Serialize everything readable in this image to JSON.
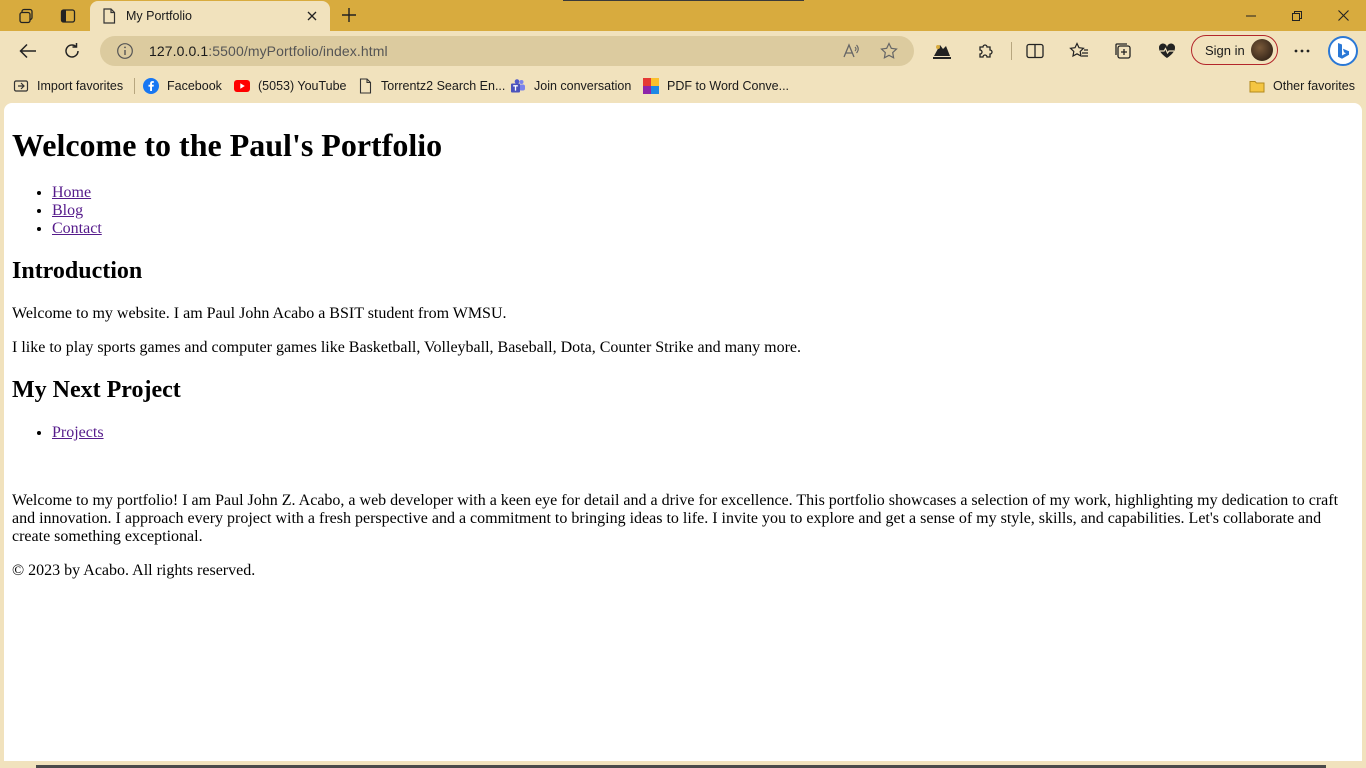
{
  "browser": {
    "tab_title": "My Portfolio",
    "url_host": "127.0.0.1",
    "url_path": ":5500/myPortfolio/index.html",
    "signin_label": "Sign in",
    "accent_color": "#d8ab3e",
    "favorites": [
      {
        "label": "Import favorites",
        "icon": "import-icon"
      },
      {
        "label": "Facebook",
        "icon": "facebook-icon"
      },
      {
        "label": "(5053) YouTube",
        "icon": "youtube-icon"
      },
      {
        "label": "Torrentz2 Search En...",
        "icon": "page-icon"
      },
      {
        "label": "Join conversation",
        "icon": "teams-icon"
      },
      {
        "label": "PDF to Word Conve...",
        "icon": "pdf-icon"
      }
    ],
    "other_favorites": "Other favorites"
  },
  "page": {
    "title": "Welcome to the Paul's Portfolio",
    "nav": [
      "Home",
      "Blog",
      "Contact"
    ],
    "intro_heading": "Introduction",
    "intro_p1": "Welcome to my website. I am Paul John Acabo a BSIT student from WMSU.",
    "intro_p2": "I like to play sports games and computer games like Basketball, Volleyball, Baseball, Dota, Counter Strike and many more.",
    "project_heading": "My Next Project",
    "project_link": "Projects",
    "about": "Welcome to my portfolio! I am Paul John Z. Acabo, a web developer with a keen eye for detail and a drive for excellence. This portfolio showcases a selection of my work, highlighting my dedication to craft and innovation. I approach every project with a fresh perspective and a commitment to bringing ideas to life. I invite you to explore and get a sense of my style, skills, and capabilities. Let's collaborate and create something exceptional.",
    "footer": "© 2023 by Acabo. All rights reserved."
  }
}
